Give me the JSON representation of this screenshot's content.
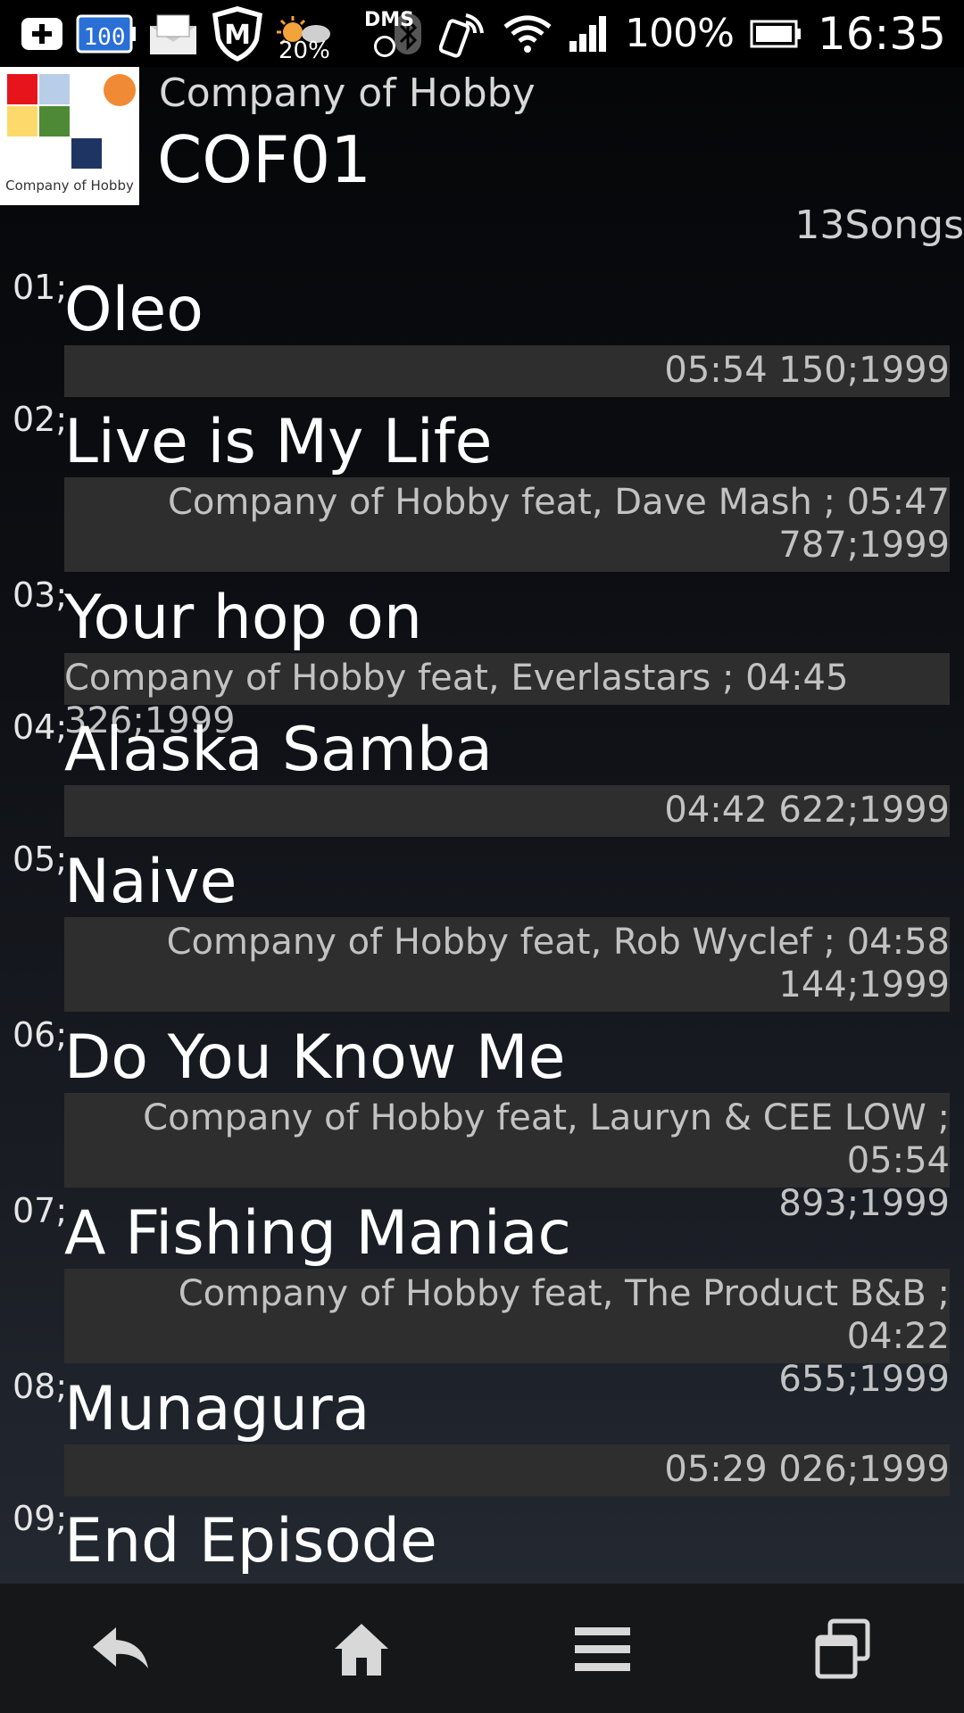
{
  "status_bar": {
    "weather_percent": "20%",
    "dms_label": "DMS",
    "battery_percent": "100%",
    "time": "16:35",
    "icons": [
      "add-icon",
      "battery-saver-icon",
      "mail-icon",
      "shield-m-icon",
      "weather-icon",
      "dms-icon",
      "bluetooth-icon",
      "nfc-icon",
      "wifi-icon",
      "signal-icon",
      "battery-icon"
    ]
  },
  "header": {
    "album_art_caption": "Company of Hobby",
    "artist": "Company of Hobby",
    "album": "COF01",
    "song_count": "13Songs"
  },
  "tracks": [
    {
      "num": "01;",
      "title": "Oleo",
      "info_line1": "05:54 150;1999",
      "info_line2": ""
    },
    {
      "num": "02;",
      "title": "Live is My Life",
      "info_line1": "Company of Hobby feat, Dave Mash ; 05:47",
      "info_line2": "787;1999"
    },
    {
      "num": "03;",
      "title": "Your hop on",
      "info_line1": "Company of Hobby feat, Everlastars ; 04:45 326;1999",
      "info_line2": ""
    },
    {
      "num": "04;",
      "title": "Alaska Samba",
      "info_line1": "04:42 622;1999",
      "info_line2": ""
    },
    {
      "num": "05;",
      "title": "Naive",
      "info_line1": "Company of Hobby feat, Rob Wyclef ; 04:58",
      "info_line2": "144;1999"
    },
    {
      "num": "06;",
      "title": "Do You Know Me",
      "info_line1": "Company of Hobby feat, Lauryn & CEE LOW ; 05:54",
      "info_line2": "893;1999"
    },
    {
      "num": "07;",
      "title": "A Fishing Maniac",
      "info_line1": "Company of Hobby feat, The Product B&B ; 04:22",
      "info_line2": "655;1999"
    },
    {
      "num": "08;",
      "title": "Munagura",
      "info_line1": "05:29 026;1999",
      "info_line2": ""
    },
    {
      "num": "09;",
      "title": "End Episode",
      "info_line1": "",
      "info_line2": ""
    }
  ],
  "nav_bar": {
    "icons": [
      "back-icon",
      "home-icon",
      "menu-icon",
      "recent-apps-icon"
    ]
  }
}
